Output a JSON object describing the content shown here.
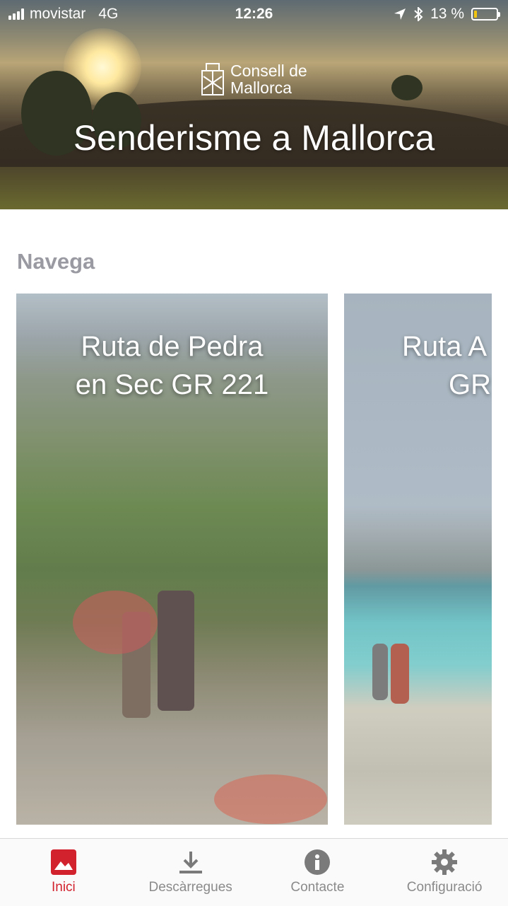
{
  "status_bar": {
    "carrier": "movistar",
    "network": "4G",
    "time": "12:26",
    "battery_percent": "13 %",
    "battery_level": 0.13
  },
  "header": {
    "logo_line1": "Consell de",
    "logo_line2": "Mallorca",
    "title": "Senderisme a Mallorca"
  },
  "section": {
    "title": "Navega"
  },
  "cards": [
    {
      "line1": "Ruta de Pedra",
      "line2": "en Sec GR 221"
    },
    {
      "line1": "Ruta A",
      "line2": "GR"
    }
  ],
  "tabs": [
    {
      "label": "Inici",
      "icon": "image-icon",
      "active": true
    },
    {
      "label": "Descàrregues",
      "icon": "download-icon",
      "active": false
    },
    {
      "label": "Contacte",
      "icon": "info-icon",
      "active": false
    },
    {
      "label": "Configuració",
      "icon": "gear-icon",
      "active": false
    }
  ],
  "colors": {
    "accent": "#d2222d",
    "inactive": "#8a8a8a"
  }
}
